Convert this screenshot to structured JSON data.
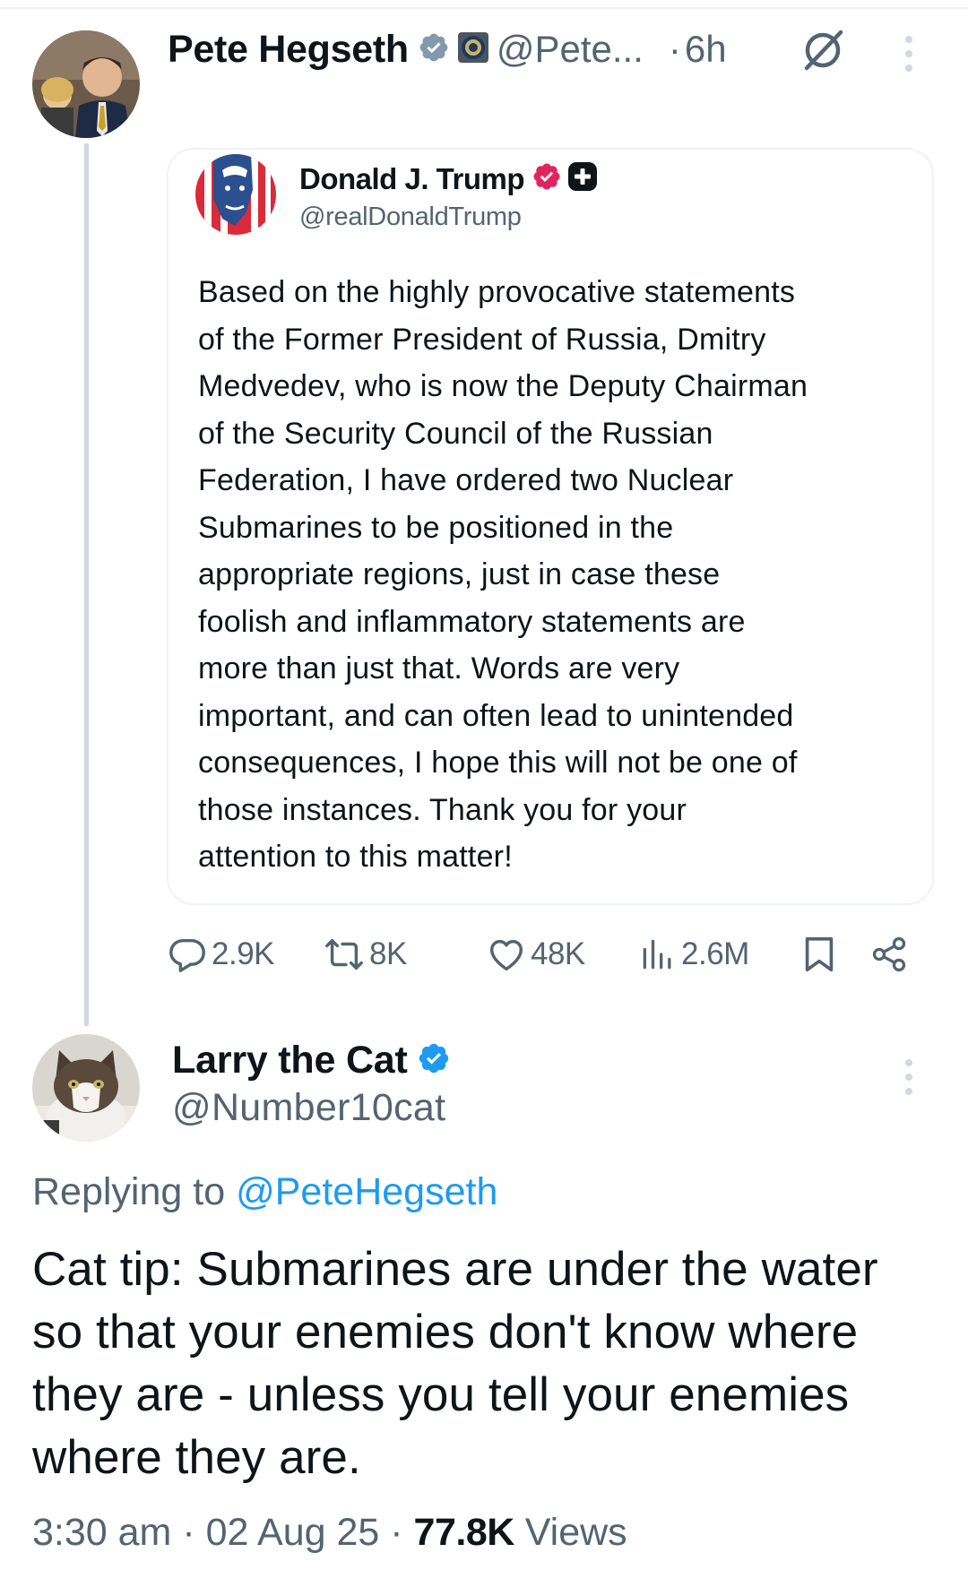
{
  "parent_tweet": {
    "author_name": "Pete Hegseth",
    "handle": "@Pete...",
    "separator": "·",
    "time": "6h",
    "icons": {
      "verified": "verified-badge-icon",
      "affiliation": "government-seal-icon",
      "grok": "grok-icon",
      "more": "more-vertical-icon"
    },
    "colors": {
      "verified": "#1d9bf0",
      "gov_badge": "#829aab"
    }
  },
  "quoted_tweet": {
    "author_name": "Donald J. Trump",
    "handle": "@realDonaldTrump",
    "colors": {
      "verified": "#e0245e"
    },
    "text_lines": [
      "Based on the highly provocative statements",
      "of the Former President of Russia, Dmitry",
      "Medvedev, who is now the Deputy Chairman",
      "of the Security Council of the Russian",
      "Federation, I have ordered two Nuclear",
      "Submarines to be positioned in the",
      "appropriate regions, just in case these",
      "foolish and inflammatory statements are",
      "more than just that. Words are very",
      "important, and can often lead to unintended",
      "consequences, I hope this will not be one of",
      "those instances. Thank you for your",
      "attention to this matter!"
    ]
  },
  "actions": {
    "replies": "2.9K",
    "reposts": "8K",
    "likes": "48K",
    "views": "2.6M"
  },
  "reply_tweet": {
    "author_name": "Larry the Cat",
    "handle": "@Number10cat",
    "replying_prefix": "Replying to",
    "replying_mention": "@PeteHegseth",
    "text_lines": [
      "Cat tip: Submarines are under the water",
      "so that your enemies don't know where",
      "they are - unless you tell your enemies",
      "where they are."
    ],
    "meta": {
      "time": "3:30 am",
      "sep1": "·",
      "date": "02 Aug 25",
      "sep2": "·",
      "views": "77.8K",
      "views_label": "Views"
    }
  }
}
